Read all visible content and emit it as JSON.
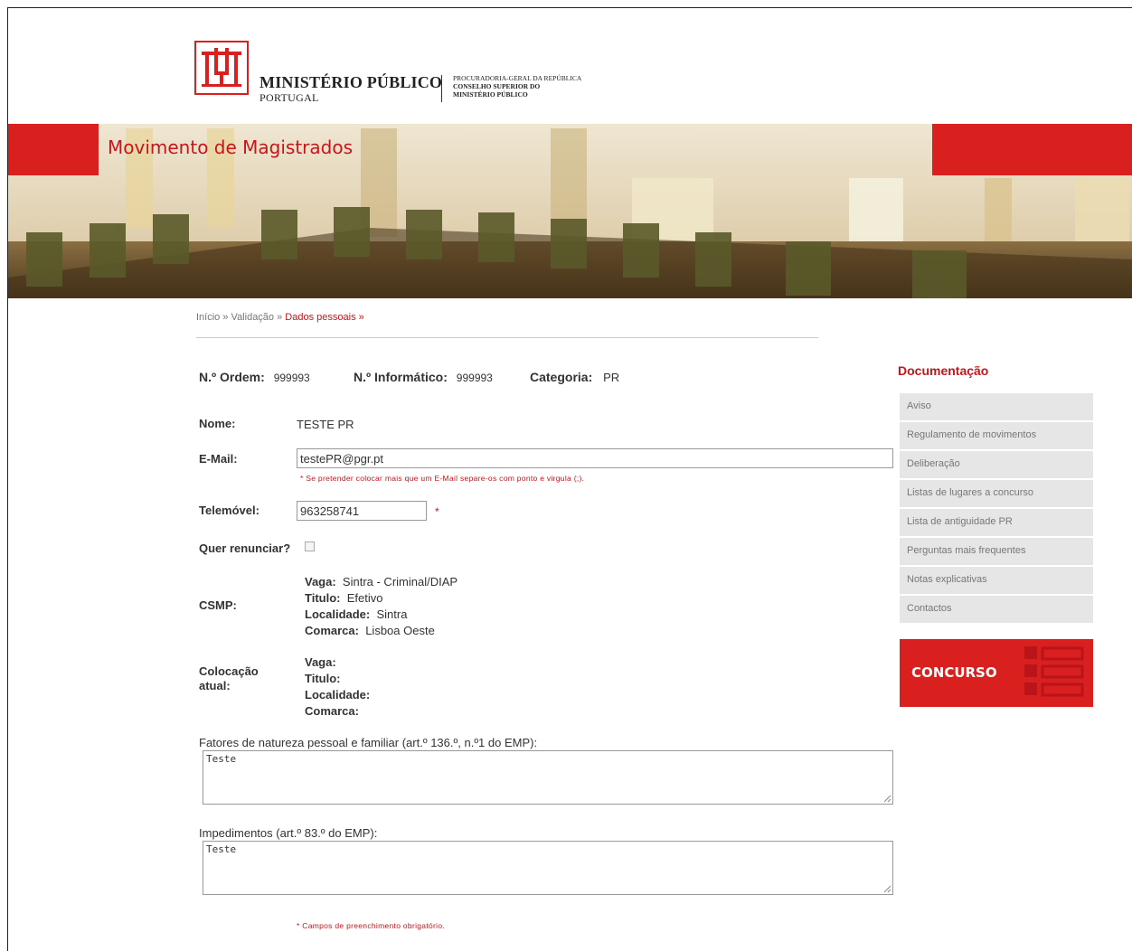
{
  "header": {
    "org_name": "MINISTÉRIO PÚBLICO",
    "org_country": "PORTUGAL",
    "sub_line1": "PROCURADORIA-GERAL DA REPÚBLICA",
    "sub_line2": "CONSELHO SUPERIOR DO",
    "sub_line3": "MINISTÉRIO PÚBLICO"
  },
  "banner": {
    "title": "Movimento de Magistrados"
  },
  "breadcrumb": {
    "items": [
      "Início",
      "Validação",
      "Dados pessoais"
    ],
    "separator": "»"
  },
  "info": {
    "ordem_label": "N.º Ordem:",
    "ordem_value": "999993",
    "informatico_label": "N.º Informático:",
    "informatico_value": "999993",
    "categoria_label": "Categoria:",
    "categoria_value": "PR"
  },
  "form": {
    "nome_label": "Nome:",
    "nome_value": "TESTE PR",
    "email_label": "E-Mail:",
    "email_value": "testePR@pgr.pt",
    "email_hint": "* Se pretender colocar mais que um E-Mail separe-os com ponto e virgula (;).",
    "telemovel_label": "Telemóvel:",
    "telemovel_value": "963258741",
    "required_mark": "*",
    "renunciar_label": "Quer renunciar?",
    "renunciar_checked": false,
    "csmp_label": "CSMP:",
    "csmp": {
      "vaga_label": "Vaga:",
      "vaga_value": "Sintra - Criminal/DIAP",
      "titulo_label": "Titulo:",
      "titulo_value": "Efetivo",
      "localidade_label": "Localidade:",
      "localidade_value": "Sintra",
      "comarca_label": "Comarca:",
      "comarca_value": "Lisboa Oeste"
    },
    "colocacao_label_1": "Colocação",
    "colocacao_label_2": "atual:",
    "colocacao": {
      "vaga_label": "Vaga:",
      "titulo_label": "Titulo:",
      "localidade_label": "Localidade:",
      "comarca_label": "Comarca:"
    },
    "fatores_label": "Fatores de natureza pessoal e familiar (art.º 136.º, n.º1 do EMP):",
    "fatores_value": "Teste",
    "impedimentos_label": "Impedimentos (art.º 83.º do EMP):",
    "impedimentos_value": "Teste",
    "footer_note": "* Campos de preenchimento obrigatório."
  },
  "sidebar": {
    "title": "Documentação",
    "items": [
      "Aviso",
      "Regulamento de movimentos",
      "Deliberação",
      "Listas de lugares a concurso",
      "Lista de antiguidade PR",
      "Perguntas mais frequentes",
      "Notas explicativas",
      "Contactos"
    ],
    "concurso_label": "CONCURSO"
  },
  "colors": {
    "brand_red": "#d9201f",
    "link_red": "#c8141b"
  }
}
